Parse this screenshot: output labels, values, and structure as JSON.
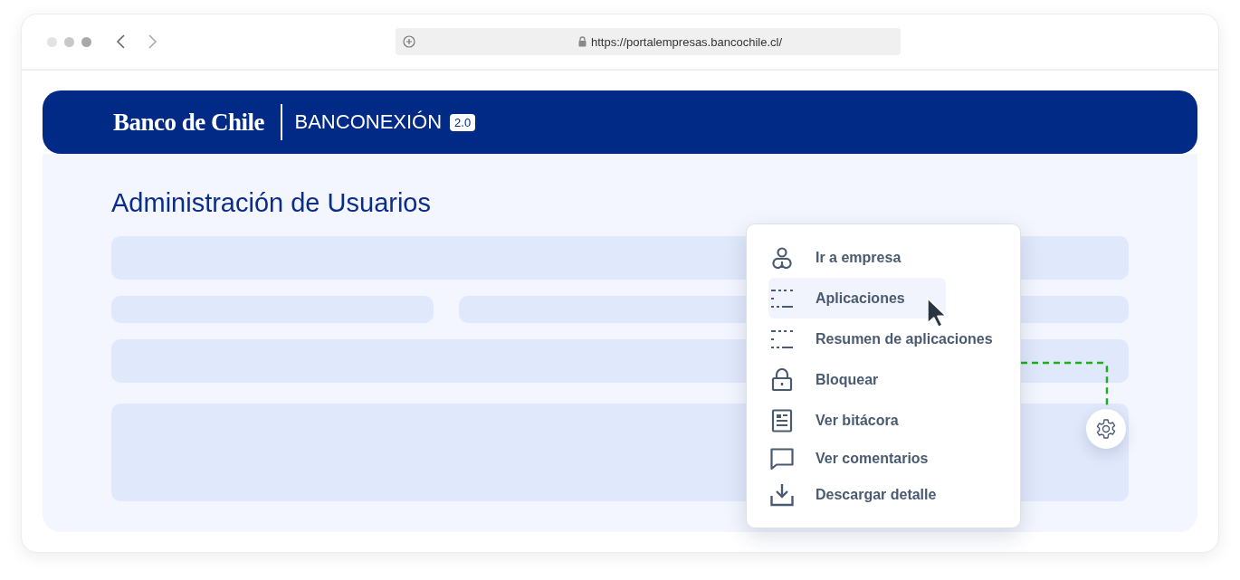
{
  "browser": {
    "url": "https://portalempresas.bancochile.cl/"
  },
  "header": {
    "logo": "Banco de Chile",
    "product": "BANCONEXIÓN",
    "version": "2.0"
  },
  "page_title": "Administración de Usuarios",
  "context_menu": {
    "items": [
      {
        "label": "Ir a empresa",
        "selected": false
      },
      {
        "label": "Aplicaciones",
        "selected": true
      },
      {
        "label": "Resumen de aplicaciones",
        "selected": false
      },
      {
        "label": "Bloquear",
        "selected": false
      },
      {
        "label": "Ver bitácora",
        "selected": false
      },
      {
        "label": "Ver comentarios",
        "selected": false
      },
      {
        "label": "Descargar detalle",
        "selected": false
      }
    ]
  }
}
